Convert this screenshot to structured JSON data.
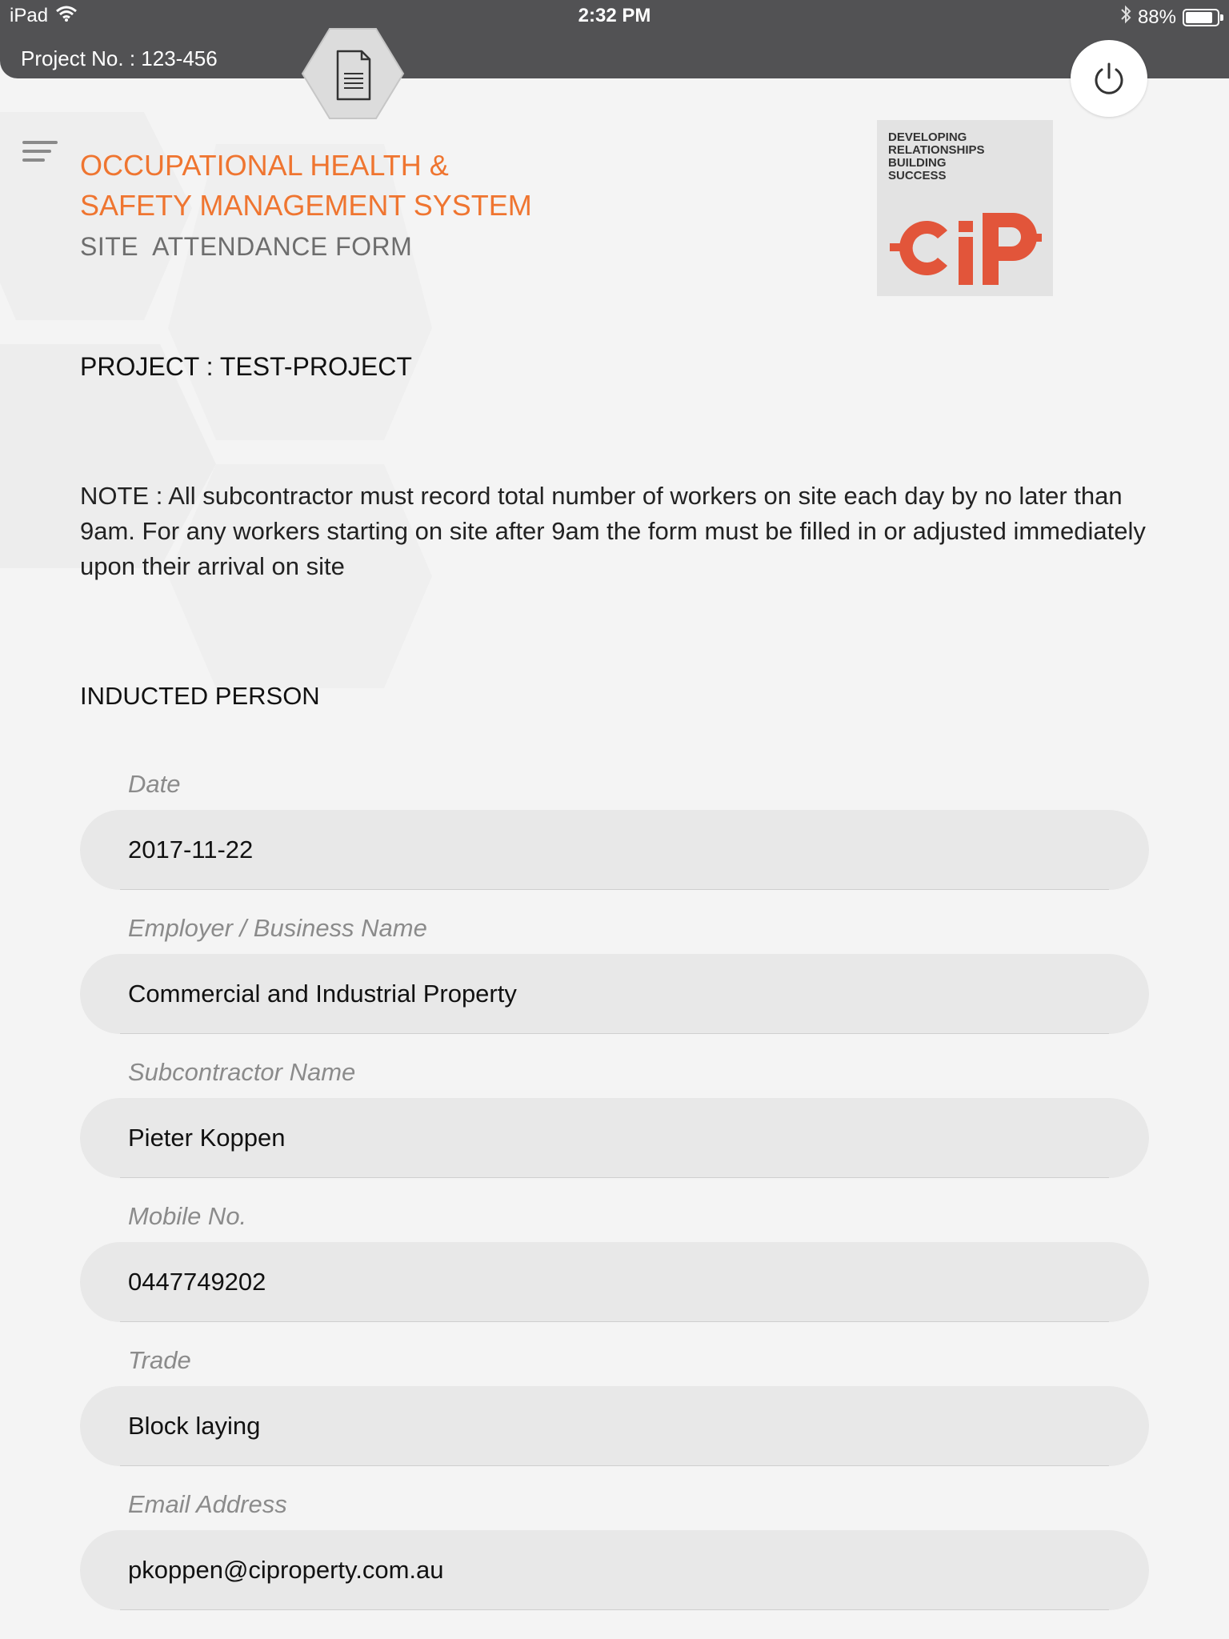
{
  "status_bar": {
    "device": "iPad",
    "time": "2:32 PM",
    "battery": "88%",
    "battery_level": 0.88
  },
  "app_bar": {
    "project_no": "Project No. : 123-456"
  },
  "header": {
    "title_line1": "OCCUPATIONAL HEALTH &",
    "title_line2": "SAFETY MANAGEMENT SYSTEM",
    "subtitle": "SITE  ATTENDANCE FORM"
  },
  "logo": {
    "tagline1": "DEVELOPING",
    "tagline2": "RELATIONSHIPS",
    "tagline3": "BUILDING",
    "tagline4": "SUCCESS",
    "mark": "CIP"
  },
  "project": {
    "line": "PROJECT : TEST-PROJECT"
  },
  "note": "NOTE : All subcontractor must record total number of workers on site each day by no later than 9am. For any workers starting on site after 9am the form must be filled in or adjusted immediately upon their arrival on site",
  "section": {
    "title": "INDUCTED PERSON"
  },
  "fields": [
    {
      "label": "Date",
      "value": "2017-11-22"
    },
    {
      "label": "Employer / Business Name",
      "value": "Commercial and Industrial Property"
    },
    {
      "label": "Subcontractor Name",
      "value": "Pieter Koppen"
    },
    {
      "label": "Mobile No.",
      "value": "0447749202"
    },
    {
      "label": "Trade",
      "value": "Block laying"
    },
    {
      "label": "Email Address",
      "value": "pkoppen@ciproperty.com.au"
    }
  ],
  "colors": {
    "accent": "#ef7530",
    "logo_red": "#e2553a",
    "bar": "#525254"
  }
}
